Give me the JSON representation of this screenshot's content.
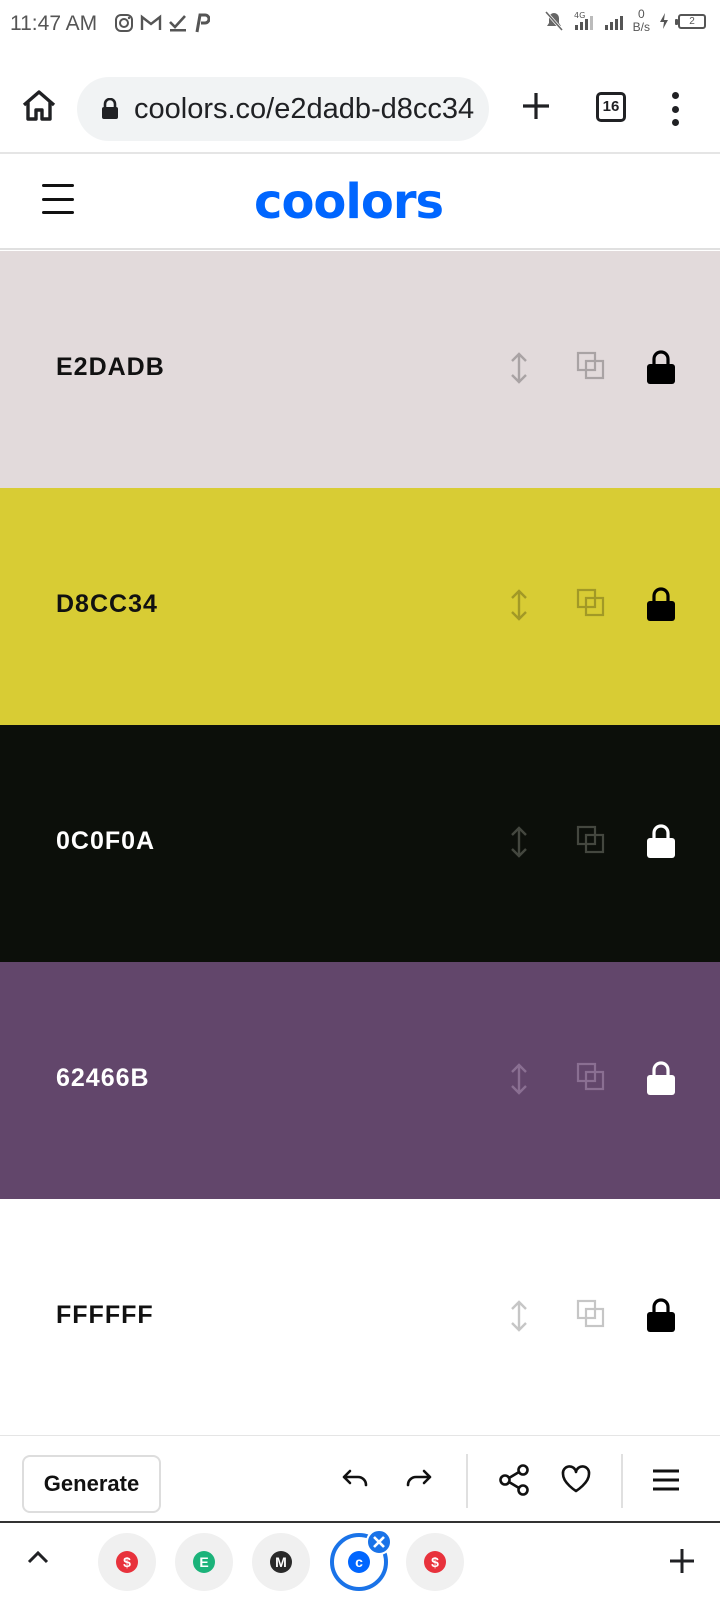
{
  "status_bar": {
    "time": "11:47 AM",
    "net_speed_value": "0",
    "net_speed_unit": "B/s",
    "network_type": "4G",
    "battery": "2"
  },
  "browser": {
    "url": "coolors.co/e2dadb-d8cc34",
    "tab_count": "16"
  },
  "app": {
    "logo_text": "coolors",
    "brand_color": "#0066ff"
  },
  "palette": [
    {
      "hex": "E2DADB",
      "color": "#e2dadb",
      "text_color": "#111111",
      "icon_color": "#a9a3a4",
      "lock_color": "#000000"
    },
    {
      "hex": "D8CC34",
      "color": "#d8cc34",
      "text_color": "#111111",
      "icon_color": "#a29926",
      "lock_color": "#000000"
    },
    {
      "hex": "0C0F0A",
      "color": "#0c0f0a",
      "text_color": "#ffffff",
      "icon_color": "#44473f",
      "lock_color": "#ffffff"
    },
    {
      "hex": "62466B",
      "color": "#62466b",
      "text_color": "#ffffff",
      "icon_color": "#8a6f92",
      "lock_color": "#ffffff"
    },
    {
      "hex": "FFFFFF",
      "color": "#ffffff",
      "text_color": "#111111",
      "icon_color": "#c6c6c6",
      "lock_color": "#000000"
    }
  ],
  "toolbar": {
    "generate_label": "Generate"
  },
  "tab_strip": {
    "tabs": [
      {
        "icon": "red-dollar-favicon",
        "color": "#e8323c",
        "glyph": "$"
      },
      {
        "icon": "green-e-favicon",
        "color": "#1bb37a",
        "glyph": "E"
      },
      {
        "icon": "yellow-m-favicon",
        "color": "#2a2a2a",
        "glyph": "M"
      },
      {
        "icon": "coolors-favicon",
        "color": "#0066ff",
        "glyph": "c",
        "active": true
      },
      {
        "icon": "red-dollar-favicon",
        "color": "#e8323c",
        "glyph": "$"
      }
    ]
  }
}
